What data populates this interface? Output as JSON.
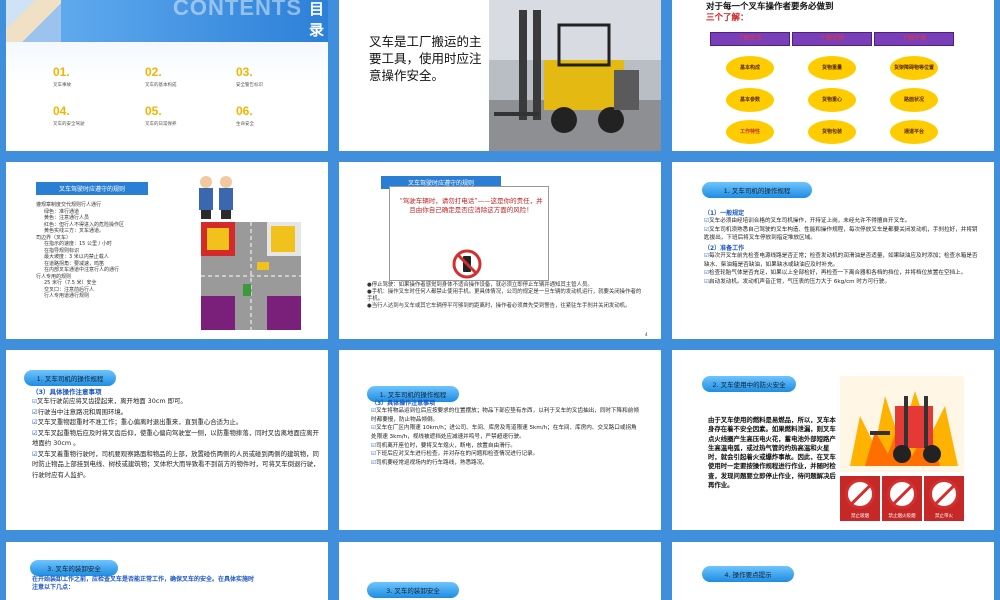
{
  "slide1": {
    "hero_word": "CONTENTS",
    "hero_cn": "目录",
    "items": [
      {
        "num": "01.",
        "label": "叉车事故"
      },
      {
        "num": "02.",
        "label": "叉车的基本构成"
      },
      {
        "num": "03.",
        "label": "安全警告标识"
      },
      {
        "num": "04.",
        "label": "叉车的安全驾驶"
      },
      {
        "num": "05.",
        "label": "叉车的日常保养"
      },
      {
        "num": "06.",
        "label": "生命安全"
      }
    ]
  },
  "slide2": {
    "text": "叉车是工厂搬运的主要工具，使用时应注意操作安全。"
  },
  "slide3": {
    "head_line1": "对于每一个叉车操作者要务必做到",
    "head_line2": "三个了解：",
    "categories": [
      "了解叉车",
      "了解货物",
      "了解环境"
    ],
    "col1": [
      "基本构成",
      "基本参数",
      "工作特性"
    ],
    "col2": [
      "货物重量",
      "货物重心",
      "货物包装"
    ],
    "col3": [
      "货架障碍物等位置",
      "路面状况",
      "通道平台"
    ]
  },
  "slide4": {
    "title": "叉车驾驶时应遵守的规则",
    "lines": [
      "遵规章制度交代规则行人通行",
      "绿色：准行通道",
      "黄色：注意通行人员",
      "红色：但行人不得进入的危险操作区",
      "黄色实线三方：叉车通道。",
      "司边界（叉车）",
      "在指示的速度：15 公里 / 小时",
      "在指导规则标识",
      "最大坡度：3 米以内禁止载人",
      "在道路拐角：要减速，鸣笛",
      "在内部叉车通道中注意行人的通行",
      "行人专用的规则",
      "25 米行（7.5 米）安全",
      "交叉口：注意前后行人",
      "行人专用道通行规则"
    ]
  },
  "slide5": {
    "title": "叉车驾驶时应遵守的规则",
    "warning": "“驾驶车辆时，请勿打电话”——这是你的责任，并且由你自己确定是否应消除这方面的风险！",
    "bullets": [
      "●停止驾驶：如果操作者感觉到身体不适合操作设备，就必须立即停止车辆并通知其主管人员。",
      "●手机：操作叉车时任何人都禁止使用手机。更具体情况，公司的规定是一旦车辆的发动机运行，就要关闭操作者的手机。",
      "●当行人达到与叉车或其它车辆停平可够到的距离时，操作者必须首先受到警告，往紧驻车手刹并关闭发动机。"
    ],
    "page_no": "4"
  },
  "slide6": {
    "pill": "1. 叉车司机的操作规程",
    "sub1": "（1）一般规定",
    "lines1": [
      "叉车必须由经培训合格的叉车司机操作，开持证上岗，未经允许不得擅自开叉车。",
      "叉车司机须熟悉自己驾驶的叉车构造、性能和操作规程，每次停放叉车是都要关闭发动机，手刹拉好，并将钥匙拔出，下班后将叉车停放到指定堆放区域。"
    ],
    "sub2": "（2）准备工作",
    "lines2": [
      "每次开叉车前先检查电源线路是否正常；检查发动机的润滑油是否适量，如果缺油应及时添加；检查水箱是否缺水、柴油箱是否缺油，如果缺水或缺油应及时补充。",
      "检查轮胎气体是否充足，如果以上全部检好，再检查一下离合器和各档的挡位，并将档位放置在空挡上。",
      "启动发动机。发动机声音正常，气压表的压力大于 6kg/cm 时方可行驶。"
    ]
  },
  "slide7": {
    "pill": "1. 叉车司机的操作规程",
    "sub": "（3）具体操作注意事项",
    "lines": [
      "叉车行驶前应将叉齿提起来，离开地面 30cm 即可。",
      "行驶当中注意路况和周围环境。",
      "叉车叉重物超重时不准工作；重心偏离时退出重来，直到重心合适为止。",
      "叉车叉起重物后应及时将叉齿后仰，使重心偏向驾驶室一侧，以防重物摔落，同时叉齿离地面应离开地面约 30cm 。",
      "叉车叉着重物行驶时，司机要观察路面和物品的上部，放置碰伤两侧的人员或碰到两侧的建筑物，同时防止物品上部挂到电线、树枝或建筑物；叉体积大而导致看不到前方的物件时，可将叉车倒退行驶，行驶时应有人监护。"
    ]
  },
  "slide8": {
    "pill": "1. 叉车司机的操作规程",
    "sub": "（3）具体操作注意事项",
    "lines": [
      "叉车将物品运到位后应按要求的位置摆放；物品下部应垫有东西，以利于叉车的叉齿抽出，同时下降和前倾时都要慢，防止物品倾倒。",
      "叉车在厂区内限速 10km/h；进公司、车间、库房及弯道限速 5km/h；在车间、库房内、交叉路口或拐角处限速 3km/h，视线被遮挡处应减速并鸣号，严禁超速行驶。",
      "司机离开座位时，要将叉车熄火，断电，放置自由滑行。",
      "下班后应对叉车进行检查，并对存在的问题和检查情况进行记录。",
      "司机要经常巡视场内的行车路线，熟悉路况。"
    ]
  },
  "slide9": {
    "pill": "2. 叉车使用中的防火安全",
    "text": "由于叉车使用的燃料是易燃品，所以，叉车本身存在着不安全因素。如果燃料泄漏，则叉车点火线圈产生高压电火花，蓄电池外部短路产生高温电弧，或过热气管的灼热高温和火星时，就会引起着火或爆炸事故。因此，在叉车使用时一定要按操作规程进行作业，并随时检查，发现问题要立即停止作业，待问题解决后再作业。",
    "signs": [
      "禁止吸烟",
      "禁止烟火吸烟",
      "禁止带火"
    ]
  },
  "slide10": {
    "pill": "3. 叉车的装卸安全",
    "red1": "在开始装卸工作之前，应检查叉车是否能正常工作，确保叉车的安全。在具体实施时",
    "red2": "注意以下几点："
  },
  "slide11": {
    "pill": "3. 叉车的装卸安全"
  },
  "slide12": {
    "pill": "4. 操作要点提示"
  }
}
